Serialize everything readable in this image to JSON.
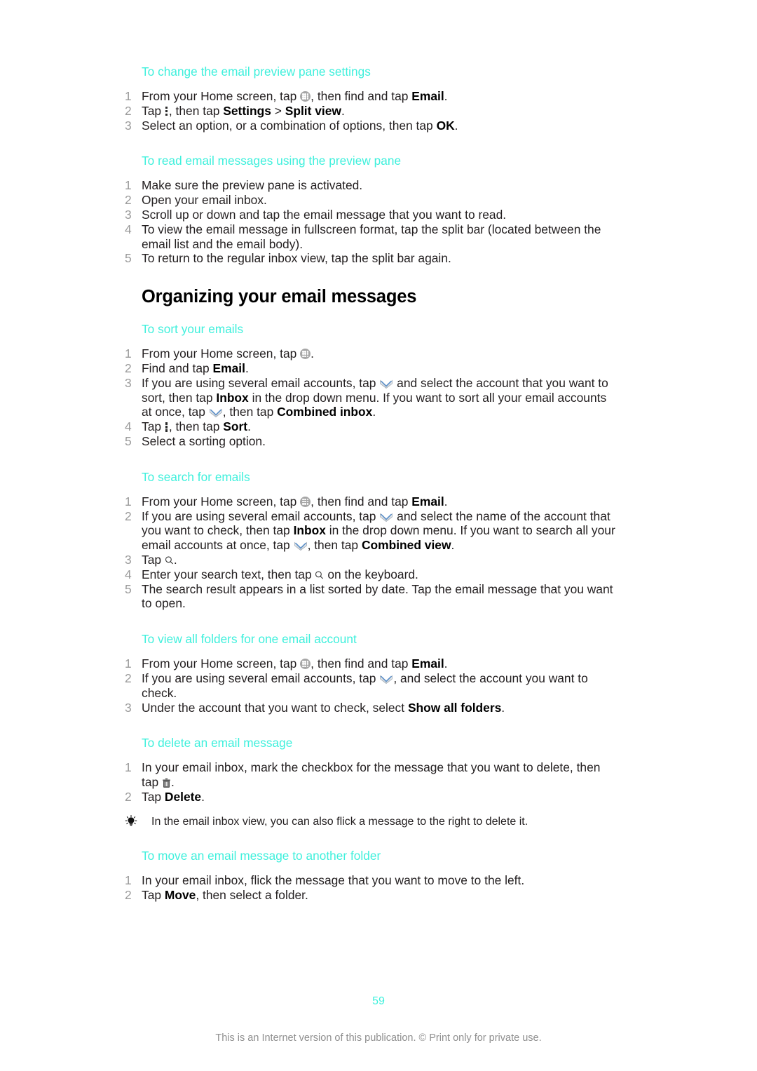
{
  "document": {
    "page_number": "59",
    "footer_note": "This is an Internet version of this publication. © Print only for private use.",
    "accent_color": "#3ef0dc",
    "number_color": "#9a9a9a",
    "body_color": "#231f20"
  },
  "procedures": {
    "preview_settings": {
      "title": "To change the email preview pane settings",
      "steps": [
        {
          "num": "1",
          "text": "From your Home screen, tap  , then find and tap Email."
        },
        {
          "num": "2",
          "text": "Tap  , then tap Settings > Split view."
        },
        {
          "num": "3",
          "text": "Select an option, or a combination of options, then tap OK."
        }
      ]
    },
    "read_preview": {
      "title": "To read email messages using the preview pane",
      "steps": [
        {
          "num": "1",
          "text": "Make sure the preview pane is activated."
        },
        {
          "num": "2",
          "text": "Open your email inbox."
        },
        {
          "num": "3",
          "text": "Scroll up or down and tap the email message that you want to read."
        },
        {
          "num": "4",
          "text": "To view the email message in fullscreen format, tap the split bar (located between the email list and the email body)."
        },
        {
          "num": "5",
          "text": "To return to the regular inbox view, tap the split bar again."
        }
      ]
    },
    "sort_emails": {
      "title": "To sort your emails",
      "steps": [
        {
          "num": "1",
          "text": "From your Home screen, tap  ."
        },
        {
          "num": "2",
          "text": "Find and tap Email."
        },
        {
          "num": "3",
          "text": "If you are using several email accounts, tap   and select the account that you want to sort, then tap Inbox in the drop down menu. If you want to sort all your email accounts at once, tap  , then tap Combined inbox."
        },
        {
          "num": "4",
          "text": "Tap  , then tap Sort."
        },
        {
          "num": "5",
          "text": "Select a sorting option."
        }
      ]
    },
    "search_emails": {
      "title": "To search for emails",
      "steps": [
        {
          "num": "1",
          "text": "From your Home screen, tap  , then find and tap Email."
        },
        {
          "num": "2",
          "text": "If you are using several email accounts, tap   and select the name of the account that you want to check, then tap Inbox in the drop down menu. If you want to search all your email accounts at once, tap  , then tap Combined view."
        },
        {
          "num": "3",
          "text": "Tap  ."
        },
        {
          "num": "4",
          "text": "Enter your search text, then tap   on the keyboard."
        },
        {
          "num": "5",
          "text": "The search result appears in a list sorted by date. Tap the email message that you want to open."
        }
      ]
    },
    "view_folders": {
      "title": "To view all folders for one email account",
      "steps": [
        {
          "num": "1",
          "text": "From your Home screen, tap  , then find and tap Email."
        },
        {
          "num": "2",
          "text": "If you are using several email accounts, tap  , and select the account you want to check."
        },
        {
          "num": "3",
          "text": "Under the account that you want to check, select Show all folders."
        }
      ]
    },
    "delete_message": {
      "title": "To delete an email message",
      "steps": [
        {
          "num": "1",
          "text": "In your email inbox, mark the checkbox for the message that you want to delete, then tap  ."
        },
        {
          "num": "2",
          "text": "Tap Delete."
        }
      ],
      "tip": "In the email inbox view, you can also flick a message to the right to delete it."
    },
    "move_message": {
      "title": "To move an email message to another folder",
      "steps": [
        {
          "num": "1",
          "text": "In your email inbox, flick the message that you want to move to the left."
        },
        {
          "num": "2",
          "text": "Tap Move, then select a folder."
        }
      ]
    }
  },
  "section": {
    "organizing_title": "Organizing your email messages"
  },
  "fragments": {
    "from_home_screen_tap": "From your Home screen, tap",
    "then_find_and_tap": ", then find and tap",
    "email_bold": "Email",
    "period": ".",
    "tap": "Tap",
    "then_tap": ", then tap",
    "settings_bold": "Settings",
    "gt": ">",
    "split_view_bold": "Split view",
    "step3_preview": "Select an option, or a combination of options, then tap",
    "ok_bold": "OK",
    "read1": "Make sure the preview pane is activated.",
    "read2": "Open your email inbox.",
    "read3": "Scroll up or down and tap the email message that you want to read.",
    "read4": "To view the email message in fullscreen format, tap the split bar (located between the email list and the email body).",
    "read5": "To return to the regular inbox view, tap the split bar again.",
    "find_and_tap": "Find and tap",
    "sort3a": "If you are using several email accounts, tap",
    "sort3b": "and select the account that you want to sort, then tap",
    "inbox_bold": "Inbox",
    "sort3c": "in the drop down menu. If you want to sort all your email accounts at once, tap",
    "sort3d": ", then tap",
    "combined_inbox_bold": "Combined inbox",
    "sort_bold": "Sort",
    "sort5": "Select a sorting option.",
    "search2a": "If you are using several email accounts, tap",
    "search2b": "and select the name of the account that you want to check, then tap",
    "search2c": "in the drop down menu. If you want to search all your email accounts at once, tap",
    "combined_view_bold": "Combined view",
    "search4a": "Enter your search text, then tap",
    "search4b": "on the keyboard.",
    "search5": "The search result appears in a list sorted by date. Tap the email message that you want to open.",
    "folders2a": "If you are using several email accounts, tap",
    "folders2b": ", and select the account you want to check.",
    "folders3a": "Under the account that you want to check, select",
    "show_all_folders_bold": "Show all folders",
    "delete1a": "In your email inbox, mark the checkbox for the message that you want to delete, then tap",
    "delete_bold": "Delete",
    "tip_delete": "In the email inbox view, you can also flick a message to the right to delete it.",
    "move1": "In your email inbox, flick the message that you want to move to the left.",
    "move_bold": "Move",
    "move2b": ", then select a folder."
  },
  "icons": {
    "apps": "apps-grid-icon",
    "menu": "overflow-menu-icon",
    "chevron": "chevron-down-icon",
    "search": "search-icon",
    "trash": "trash-icon",
    "tip": "lightbulb-icon"
  }
}
